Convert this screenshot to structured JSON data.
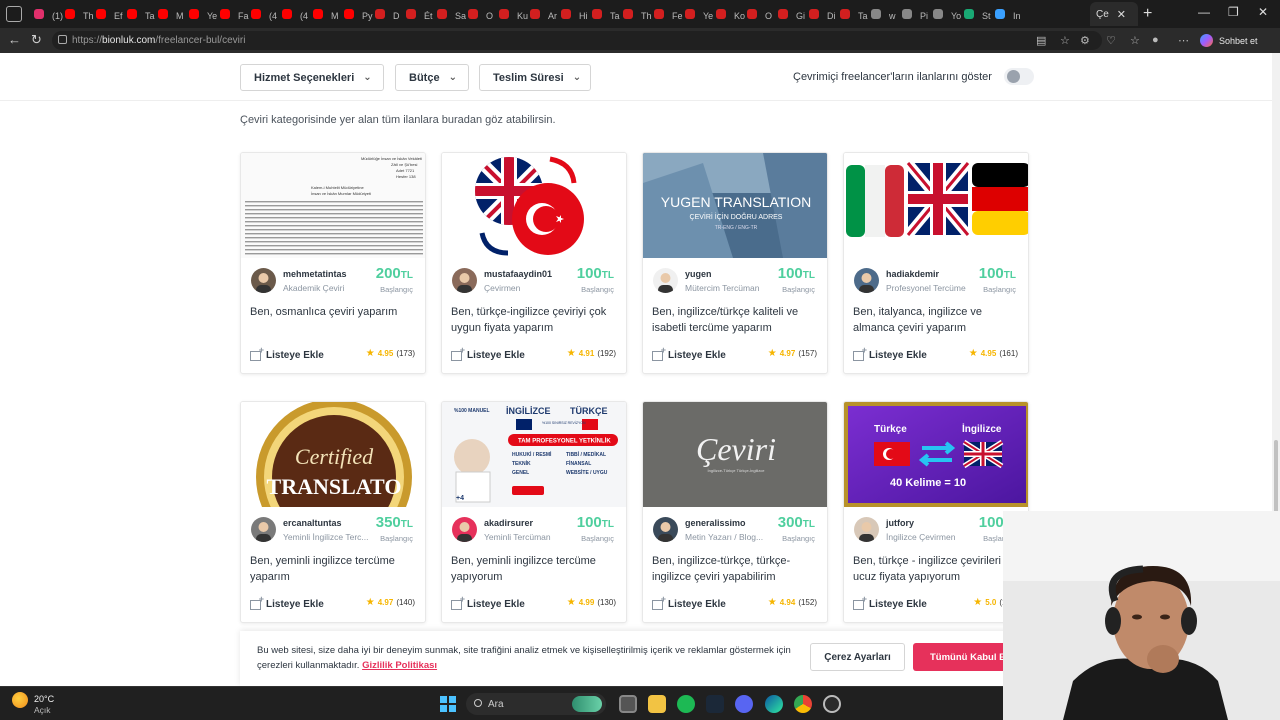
{
  "browser": {
    "active_tab_label": "Çe",
    "url_prefix": "https://",
    "url_host": "bionluk.com",
    "url_path": "/freelancer-bul/ceviri",
    "copilot_label": "Sohbet et",
    "tabs": [
      "(1)",
      "Th",
      "Ef",
      "Ta",
      "M",
      "Ye",
      "Fa",
      "(4",
      "(4",
      "M",
      "Py",
      "D",
      "Ét",
      "Sa",
      "O",
      "Ku",
      "Ar",
      "Hi",
      "Ta",
      "Th",
      "Fe",
      "Ye",
      "Ko",
      "O",
      "Gi",
      "Di",
      "Ta",
      "w",
      "Pi",
      "Yo",
      "St",
      "In"
    ]
  },
  "filters": {
    "service_options": "Hizmet Seçenekleri",
    "budget": "Bütçe",
    "delivery_time": "Teslim Süresi",
    "online_toggle_label": "Çevrimiçi freelancer'ların ilanlarını göster"
  },
  "category_description": "Çeviri kategorisinde yer alan tüm ilanlara buradan göz atabilirsin.",
  "price_note": "Başlangıç",
  "currency": "TL",
  "add_to_list_label": "Listeye Ekle",
  "cards": [
    {
      "username": "mehmetatintas",
      "title": "Akademik Çeviri",
      "price": "200",
      "score": "4.95",
      "count": "(173)",
      "desc": "Ben, osmanlıca çeviri yaparım"
    },
    {
      "username": "mustafaaydin01",
      "title": "Çevirmen",
      "price": "100",
      "score": "4.91",
      "count": "(192)",
      "desc": "Ben, türkçe-ingilizce çeviriyi çok uygun fiyata yaparım"
    },
    {
      "username": "yugen",
      "title": "Mütercim Tercüman",
      "price": "100",
      "score": "4.97",
      "count": "(157)",
      "desc": "Ben, ingilizce/türkçe kaliteli ve isabetli tercüme yaparım"
    },
    {
      "username": "hadiakdemir",
      "title": "Profesyonel Tercüme",
      "price": "100",
      "score": "4.95",
      "count": "(161)",
      "desc": "Ben, italyanca, ingilizce ve almanca çeviri yaparım"
    },
    {
      "username": "ercanaltuntas",
      "title": "Yeminli İngilizce Terc...",
      "price": "350",
      "score": "4.97",
      "count": "(140)",
      "desc": "Ben, yeminli ingilizce tercüme yaparım"
    },
    {
      "username": "akadirsurer",
      "title": "Yeminli Tercüman",
      "price": "100",
      "score": "4.99",
      "count": "(130)",
      "desc": "Ben, yeminli ingilizce tercüme yapıyorum"
    },
    {
      "username": "generalissimo",
      "title": "Metin Yazarı / Blog...",
      "price": "300",
      "score": "4.94",
      "count": "(152)",
      "desc": "Ben, ingilizce-türkçe, türkçe-ingilizce çeviri yapabilirim"
    },
    {
      "username": "jutfory",
      "title": "İngilizce Çevirmen",
      "price": "100",
      "score": "5.0",
      "count": "(157)",
      "desc": "Ben, türkçe - ingilizce çevirileri en ucuz fiyata yapıyorum"
    }
  ],
  "card_images": {
    "c1_doc_lines": [
      "Müdürlüğe İnsan ve İskân Vekâleti",
      "Zâtî ve Şû'besi",
      "Adet 7721",
      "Hesfer 138",
      "Kalem-i Muhtelit Müdüriyetine",
      "İnsan ve İskân Murnlar Müdüriyeti"
    ],
    "c3_brand": "YUGEN TRANSLATION",
    "c3_tag": "ÇEVİRİ İÇİN DOĞRU ADRES",
    "c3_langs": "TR-ENG / ENG-TR",
    "c5_text1": "Certified",
    "c5_text2": "TRANSLATO",
    "c6_badge": "%100 MANUEL",
    "c6_en": "İNGİLİZCE",
    "c6_tr": "TÜRKÇE",
    "c6_pro": "TAM PROFESYONEL YETKİNLİK",
    "c6_items": [
      "HUKUKİ / RESMİ",
      "TEKNİK",
      "GENEL",
      "TIBBİ / MEDİKAL",
      "FİNANSAL",
      "WEBSİTE / UYGU"
    ],
    "c6_plus": "+4",
    "c6_rev": "%100 SINIRSIZ REVİZYON",
    "c7_script": "Çeviri",
    "c7_sub": "İngilizce-Türkçe Türkçe-İngilizce",
    "c8_lang1": "Türkçe",
    "c8_lang2": "İngilizce",
    "c8_offer": "40 Kelime = 10"
  },
  "cookie": {
    "text": "Bu web sitesi, size daha iyi bir deneyim sunmak, site trafiğini analiz etmek ve kişiselleştirilmiş içerik ve reklamlar göstermek için çerezleri kullanmaktadır.",
    "link": "Gizlilik Politikası",
    "settings_button": "Çerez Ayarları",
    "accept_button": "Tümünü Kabul Et"
  },
  "taskbar": {
    "temperature": "20°C",
    "condition": "Açık",
    "search_placeholder": "Ara"
  },
  "colors": {
    "accent_pink": "#e6315b",
    "price_green": "#4fcf9e",
    "star_yellow": "#f6b500"
  }
}
